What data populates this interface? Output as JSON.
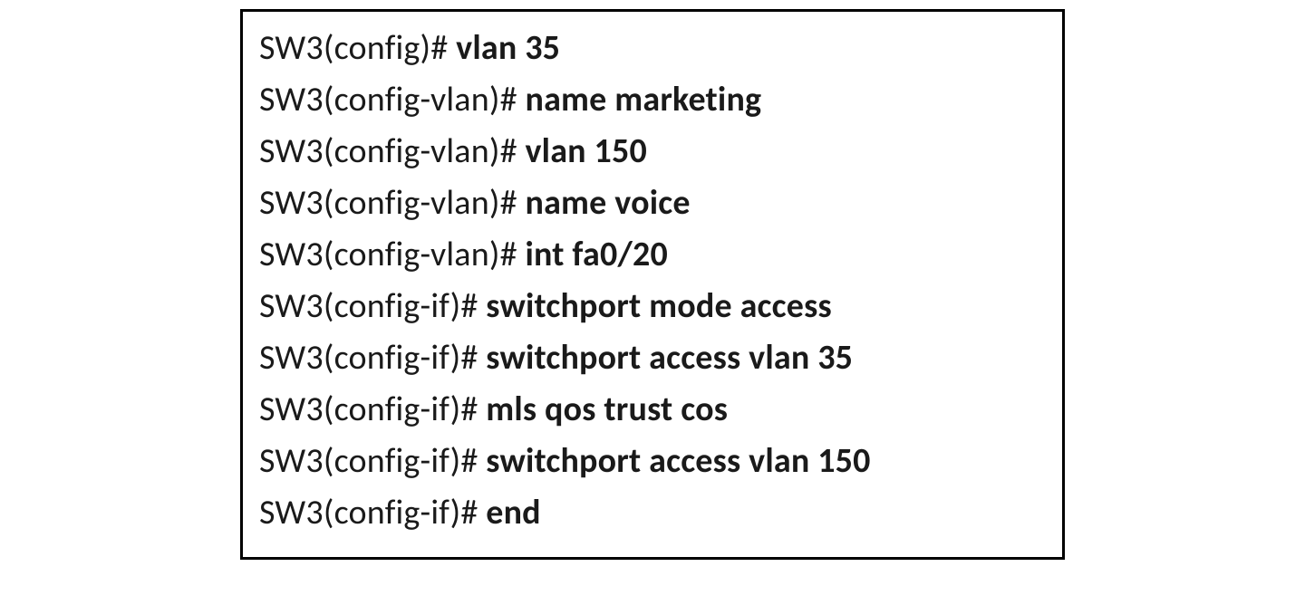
{
  "cli": {
    "lines": [
      {
        "prompt": "SW3(config)# ",
        "command": "vlan 35"
      },
      {
        "prompt": "SW3(config-vlan)# ",
        "command": "name marketing"
      },
      {
        "prompt": "SW3(config-vlan)# ",
        "command": "vlan 150"
      },
      {
        "prompt": "SW3(config-vlan)# ",
        "command": "name voice"
      },
      {
        "prompt": "SW3(config-vlan)# ",
        "command": "int fa0/20"
      },
      {
        "prompt": "SW3(config-if)# ",
        "command": "switchport mode access"
      },
      {
        "prompt": "SW3(config-if)# ",
        "command": "switchport access vlan 35"
      },
      {
        "prompt": "SW3(config-if)# ",
        "command": "mls qos trust cos"
      },
      {
        "prompt": "SW3(config-if)# ",
        "command": "switchport access vlan 150"
      },
      {
        "prompt": "SW3(config-if)# ",
        "command": "end"
      }
    ]
  }
}
